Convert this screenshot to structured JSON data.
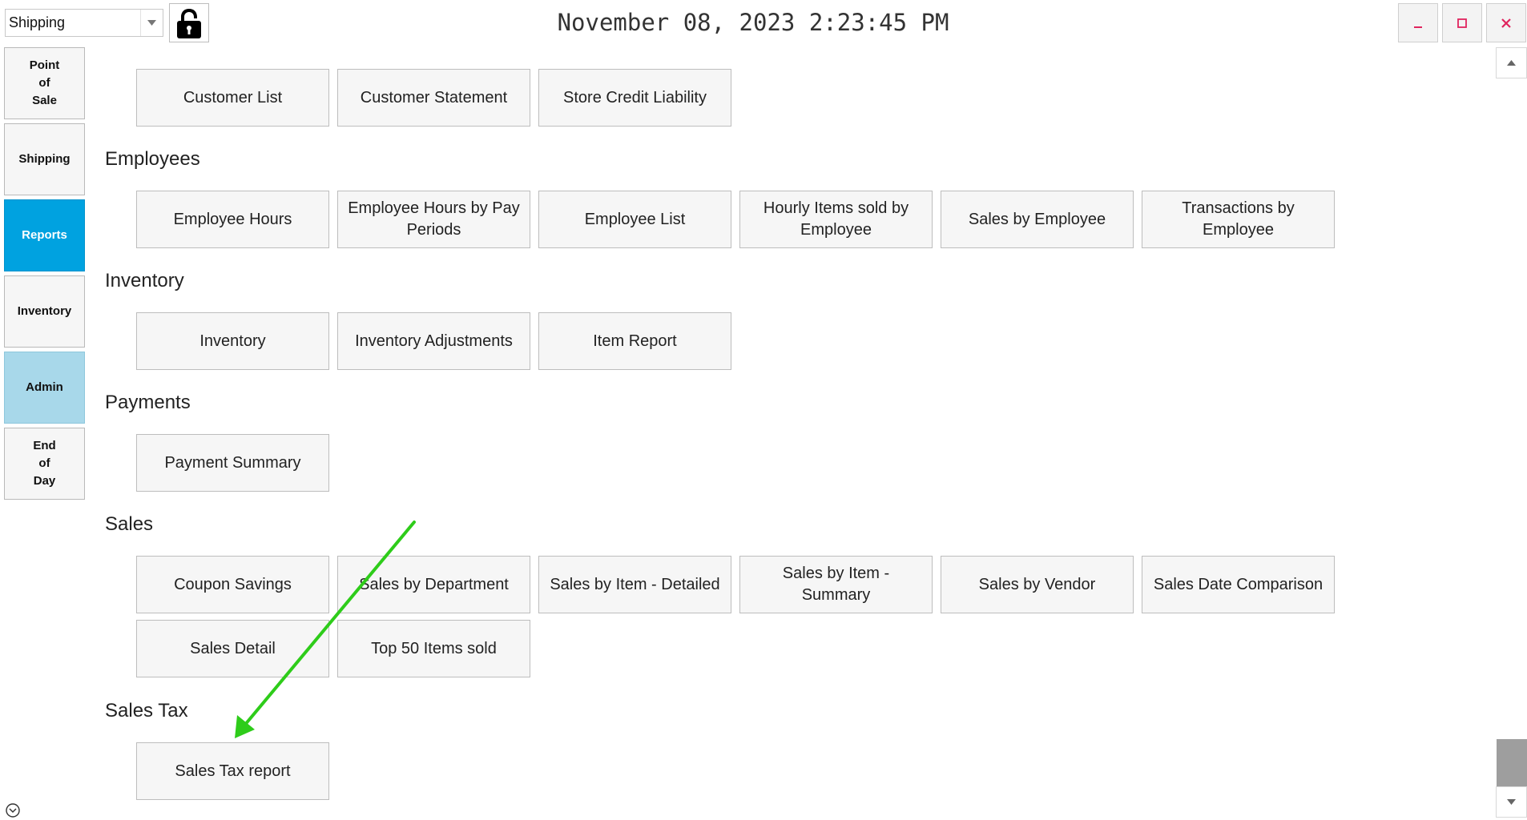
{
  "header": {
    "store_select": "Shipping",
    "datetime": "November 08, 2023 2:23:45 PM"
  },
  "sidebar": {
    "items": [
      {
        "label": "Point\nof\nSale"
      },
      {
        "label": "Shipping"
      },
      {
        "label": "Reports"
      },
      {
        "label": "Inventory"
      },
      {
        "label": "Admin"
      },
      {
        "label": "End\nof\nDay"
      }
    ]
  },
  "sections": {
    "customers": {
      "buttons": [
        "Customer List",
        "Customer Statement",
        "Store Credit Liability"
      ]
    },
    "employees": {
      "title": "Employees",
      "buttons": [
        "Employee Hours",
        "Employee Hours by Pay Periods",
        "Employee List",
        "Hourly Items sold by Employee",
        "Sales by Employee",
        "Transactions by Employee"
      ]
    },
    "inventory": {
      "title": "Inventory",
      "buttons": [
        "Inventory",
        "Inventory Adjustments",
        "Item Report"
      ]
    },
    "payments": {
      "title": "Payments",
      "buttons": [
        "Payment Summary"
      ]
    },
    "sales": {
      "title": "Sales",
      "buttons": [
        "Coupon Savings",
        "Sales by Department",
        "Sales by Item - Detailed",
        "Sales by Item - Summary",
        "Sales by Vendor",
        "Sales Date Comparison",
        "Sales Detail",
        "Top 50 Items sold"
      ]
    },
    "sales_tax": {
      "title": "Sales Tax",
      "buttons": [
        "Sales Tax report"
      ]
    }
  },
  "colors": {
    "active_tab": "#00a2e0",
    "admin_tab": "#a8d8ea",
    "annotation_arrow": "#2ecc1a",
    "close_icon": "#e0245e"
  },
  "icons": {
    "lock": "unlocked-padlock-icon",
    "minimize": "minimize-icon",
    "maximize": "maximize-icon",
    "close": "close-icon",
    "dropdown": "chevron-down-icon",
    "expand": "chevron-down-circle-icon"
  }
}
